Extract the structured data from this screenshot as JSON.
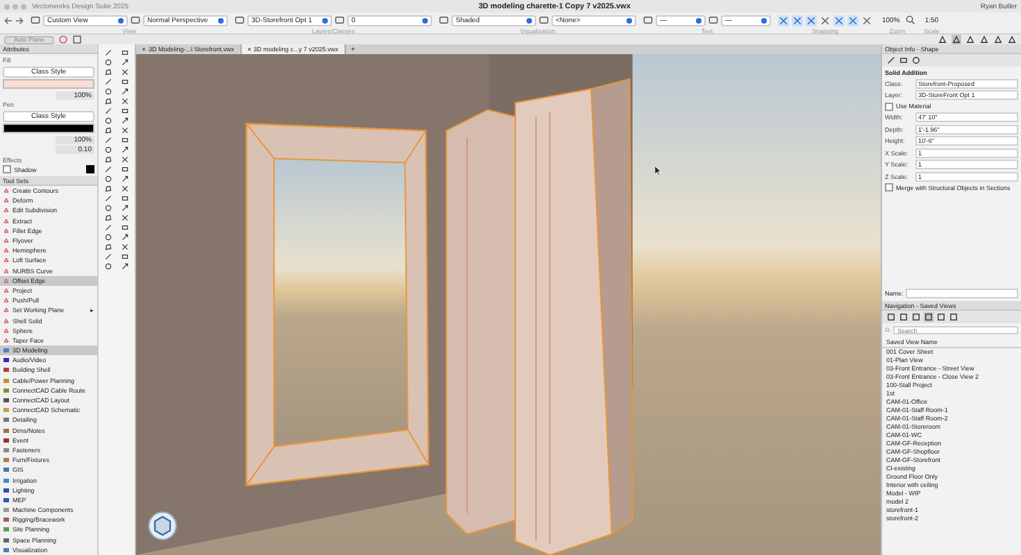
{
  "window": {
    "app_name": "Vectorworks Design Suite 2025",
    "title": "3D modeling charette-1 Copy 7 v2025.vwx",
    "user": "Ryan Butler"
  },
  "toolbar": {
    "groups": [
      {
        "label": "View",
        "fields": [
          "Custom View",
          "Normal Perspective"
        ]
      },
      {
        "label": "Layers/Classes",
        "fields": [
          "3D-Storefront Opt 1",
          "0"
        ]
      },
      {
        "label": "Visualization",
        "fields": [
          "Shaded",
          "<None>"
        ]
      },
      {
        "label": "Text",
        "fields": [
          "—",
          "—"
        ]
      }
    ],
    "snaps": [
      {
        "selected": true
      },
      {
        "selected": true
      },
      {
        "selected": true
      },
      {
        "selected": false
      },
      {
        "selected": true
      },
      {
        "selected": true
      },
      {
        "selected": false
      }
    ],
    "snapping_label": "Snapping",
    "zoom": "100%",
    "zoom_label": "Zoom",
    "scale": "1:50",
    "scale_label": "Scale"
  },
  "mode_bar": {
    "button": "Auto Plane"
  },
  "attributes": {
    "title": "Attributes",
    "fill_label": "Fill",
    "fill_style": "Class Style",
    "fill_opacity": "100%",
    "pen_label": "Pen",
    "pen_style": "Class Style",
    "pen_opacity": "100%",
    "thickness": "0.10",
    "effects_label": "Effects",
    "shadow": {
      "label": "Shadow",
      "checked": false
    }
  },
  "tool_sets": {
    "title": "Tool Sets",
    "tools": [
      {
        "name": "Create Contours",
        "selected": false,
        "submenu": false
      },
      {
        "name": "Deform",
        "selected": false,
        "submenu": false
      },
      {
        "name": "Edit Subdivision",
        "selected": false,
        "submenu": false
      },
      {
        "name": "Extract",
        "selected": false,
        "submenu": false
      },
      {
        "name": "Fillet Edge",
        "selected": false,
        "submenu": false
      },
      {
        "name": "Flyover",
        "selected": false,
        "submenu": false
      },
      {
        "name": "Hemisphere",
        "selected": false,
        "submenu": false
      },
      {
        "name": "Loft Surface",
        "selected": false,
        "submenu": false
      },
      {
        "name": "NURBS Curve",
        "selected": false,
        "submenu": false
      },
      {
        "name": "Offset Edge",
        "selected": true,
        "submenu": false
      },
      {
        "name": "Project",
        "selected": false,
        "submenu": false
      },
      {
        "name": "Push/Pull",
        "selected": false,
        "submenu": false
      },
      {
        "name": "Set Working Plane",
        "selected": false,
        "submenu": true
      },
      {
        "name": "Shell Solid",
        "selected": false,
        "submenu": false
      },
      {
        "name": "Sphere",
        "selected": false,
        "submenu": false
      },
      {
        "name": "Taper Face",
        "selected": false,
        "submenu": false
      }
    ],
    "submenu_mark": "▸",
    "categories": [
      {
        "name": "3D Modeling",
        "selected": true
      },
      {
        "name": "Audio/Video",
        "selected": false
      },
      {
        "name": "Building Shell",
        "selected": false
      },
      {
        "name": "Cable/Power Planning",
        "selected": false
      },
      {
        "name": "ConnectCAD Cable Route",
        "selected": false
      },
      {
        "name": "ConnectCAD Layout",
        "selected": false
      },
      {
        "name": "ConnectCAD Schematic",
        "selected": false
      },
      {
        "name": "Detailing",
        "selected": false
      },
      {
        "name": "Dims/Notes",
        "selected": false
      },
      {
        "name": "Event",
        "selected": false
      },
      {
        "name": "Fasteners",
        "selected": false
      },
      {
        "name": "Furn/Fixtures",
        "selected": false
      },
      {
        "name": "GIS",
        "selected": false
      },
      {
        "name": "Irrigation",
        "selected": false
      },
      {
        "name": "Lighting",
        "selected": false
      },
      {
        "name": "MEP",
        "selected": false
      },
      {
        "name": "Machine Components",
        "selected": false
      },
      {
        "name": "Rigging/Bracework",
        "selected": false
      },
      {
        "name": "Site Planning",
        "selected": false
      },
      {
        "name": "Space Planning",
        "selected": false
      },
      {
        "name": "Visualization",
        "selected": false
      }
    ]
  },
  "document_tabs": [
    {
      "label": "3D Modeling-...l Storefront.vwx",
      "selected": false
    },
    {
      "label": "3D modeling c...y 7 v2025.vwx",
      "selected": true
    }
  ],
  "new_tab": "+",
  "object_info": {
    "title": "Object Info - Shape",
    "object_type": "Solid Addition",
    "rows": [
      {
        "kind": "field",
        "label": "Class:",
        "value": "Storefront-Proposed"
      },
      {
        "kind": "field",
        "label": "Layer:",
        "value": "3D-StoreFront Opt 1"
      },
      {
        "kind": "checkbox",
        "label": "Use Material",
        "checked": false
      },
      {
        "kind": "field",
        "label": "Width:",
        "value": "47' 10\""
      },
      {
        "kind": "field",
        "label": "Depth:",
        "value": "1'-1.96\""
      },
      {
        "kind": "field",
        "label": "Height:",
        "value": "10'-6\""
      },
      {
        "kind": "field",
        "label": "X Scale:",
        "value": "1"
      },
      {
        "kind": "field",
        "label": "Y Scale:",
        "value": "1"
      },
      {
        "kind": "field",
        "label": "Z Scale:",
        "value": "1"
      },
      {
        "kind": "checkbox",
        "label": "Merge with Structural Objects in Sections",
        "checked": false
      }
    ],
    "name_label": "Name:"
  },
  "navigation": {
    "title": "Navigation - Saved Views",
    "search_placeholder": "Search",
    "column": "Saved View Name",
    "views": [
      "001 Cover Sheet",
      "01-Plan View",
      "03-Front Entrance - Street View",
      "03-Front Entrance - Close View 2",
      "100-Stall Project",
      "1st",
      "CAM-01-Office",
      "CAM-01-Staff Room-1",
      "CAM-01-Staff Room-2",
      "CAM-01-Storeroom",
      "CAM-01-WC",
      "CAM-GF-Reception",
      "CAM-GF-Shopfloor",
      "CAM-GF-Storefront",
      "Cl-existing",
      "Ground Floor Only",
      "Interior with ceiling",
      "Model - WIP",
      "model 2",
      "storefront-1",
      "storefront-2"
    ]
  }
}
